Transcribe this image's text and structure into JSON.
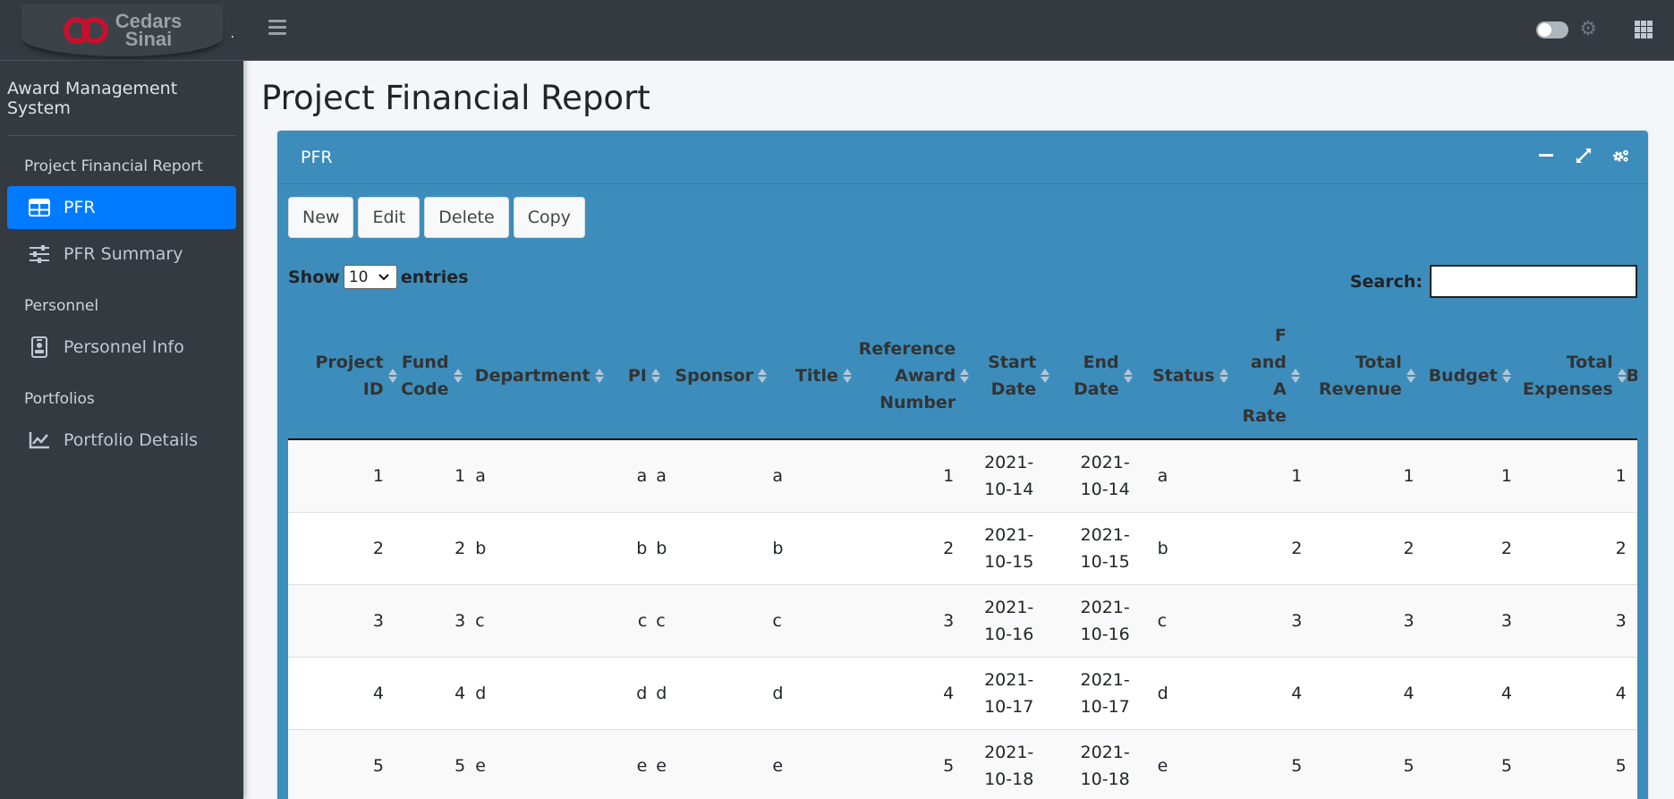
{
  "brand": {
    "logo_line1": "Cedars",
    "logo_line2": "Sinai",
    "app_name": "Award Management System"
  },
  "sidebar": {
    "sections": [
      {
        "header": "Project Financial Report",
        "items": [
          {
            "label": "PFR",
            "icon": "table-icon",
            "active": true
          },
          {
            "label": "PFR Summary",
            "icon": "sliders-icon",
            "active": false
          }
        ]
      },
      {
        "header": "Personnel",
        "items": [
          {
            "label": "Personnel Info",
            "icon": "id-badge-icon",
            "active": false
          }
        ]
      },
      {
        "header": "Portfolios",
        "items": [
          {
            "label": "Portfolio Details",
            "icon": "line-chart-icon",
            "active": false
          }
        ]
      }
    ]
  },
  "page": {
    "title": "Project Financial Report"
  },
  "card": {
    "title": "PFR"
  },
  "toolbar": {
    "new": "New",
    "edit": "Edit",
    "delete": "Delete",
    "copy": "Copy"
  },
  "table_controls": {
    "show": "Show",
    "entries": "entries",
    "length_value": "10",
    "search_label": "Search:",
    "search_value": ""
  },
  "table": {
    "columns": [
      "Project\nID",
      "Fund\nCode",
      "Department",
      "PI",
      "Sponsor",
      "Title",
      "Reference\nAward\nNumber",
      "Start\nDate",
      "End\nDate",
      "Status",
      "F\nand\nA\nRate",
      "Total\nRevenue",
      "Budget",
      "Total\nExpenses",
      "B"
    ],
    "rows": [
      [
        "1",
        "1",
        "a",
        "a",
        "a",
        "a",
        "1",
        "2021-\n10-14",
        "2021-\n10-14",
        "a",
        "1",
        "1",
        "1",
        "1"
      ],
      [
        "2",
        "2",
        "b",
        "b",
        "b",
        "b",
        "2",
        "2021-\n10-15",
        "2021-\n10-15",
        "b",
        "2",
        "2",
        "2",
        "2"
      ],
      [
        "3",
        "3",
        "c",
        "c",
        "c",
        "c",
        "3",
        "2021-\n10-16",
        "2021-\n10-16",
        "c",
        "3",
        "3",
        "3",
        "3"
      ],
      [
        "4",
        "4",
        "d",
        "d",
        "d",
        "d",
        "4",
        "2021-\n10-17",
        "2021-\n10-17",
        "d",
        "4",
        "4",
        "4",
        "4"
      ],
      [
        "5",
        "5",
        "e",
        "e",
        "e",
        "e",
        "5",
        "2021-\n10-18",
        "2021-\n10-18",
        "e",
        "5",
        "5",
        "5",
        "5"
      ]
    ]
  }
}
